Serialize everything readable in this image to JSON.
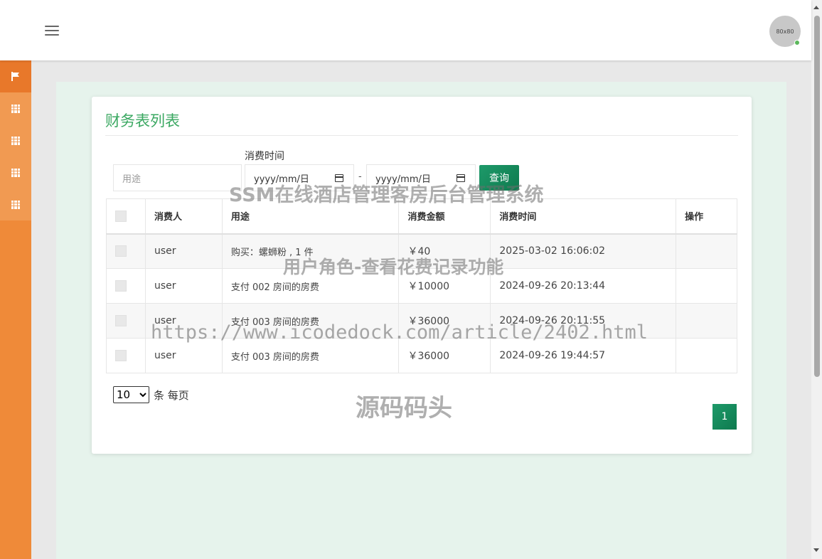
{
  "header": {
    "avatar_text": "80x80"
  },
  "sidebar": {
    "items": [
      {
        "icon": "flag-icon"
      },
      {
        "icon": "grid-icon"
      },
      {
        "icon": "grid-icon"
      },
      {
        "icon": "grid-icon"
      },
      {
        "icon": "grid-icon"
      }
    ]
  },
  "page": {
    "title": "财务表列表"
  },
  "filters": {
    "purpose_placeholder": "用途",
    "time_label": "消费时间",
    "date_start_placeholder": "yyyy/mm/日",
    "date_end_placeholder": "yyyy/mm/日",
    "date_separator": "-",
    "query_label": "查询"
  },
  "table": {
    "headers": [
      "消费人",
      "用途",
      "消费金额",
      "消费时间",
      "操作"
    ],
    "rows": [
      {
        "consumer": "user",
        "purpose": "购买：螺蛳粉 , 1 件",
        "amount": "￥40",
        "time": "2025-03-02 16:06:02"
      },
      {
        "consumer": "user",
        "purpose": "支付 002 房间的房费",
        "amount": "￥10000",
        "time": "2024-09-26 20:13:44"
      },
      {
        "consumer": "user",
        "purpose": "支付 003 房间的房费",
        "amount": "￥36000",
        "time": "2024-09-26 20:11:55"
      },
      {
        "consumer": "user",
        "purpose": "支付 003 房间的房费",
        "amount": "￥36000",
        "time": "2024-09-26 19:44:57"
      }
    ]
  },
  "pagination": {
    "page_size": "10",
    "page_size_options": [
      "10"
    ],
    "per_page_label": "条 每页",
    "current_page": "1"
  },
  "watermarks": {
    "line1": "SSM在线酒店管理客房后台管理系统",
    "line2": "用户角色-查看花费记录功能",
    "line3": "https://www.icodedock.com/article/2402.html",
    "line4": "源码码头"
  },
  "colors": {
    "sidebar": "#ef8a39",
    "accent_green": "#3ba862",
    "button_green": "#1e9a6a"
  }
}
